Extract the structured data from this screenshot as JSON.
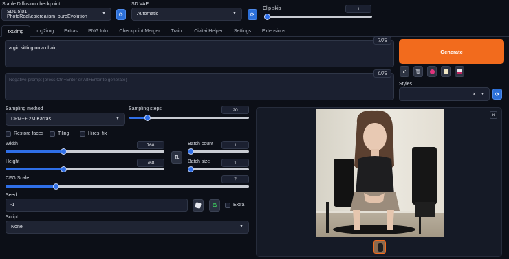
{
  "header": {
    "checkpoint_label": "Stable Diffusion checkpoint",
    "checkpoint_value": "SD1.5\\01 PhotoReal\\epicrealism_pureEvolution",
    "vae_label": "SD VAE",
    "vae_value": "Automatic",
    "clip_skip_label": "Clip skip",
    "clip_skip_value": "1",
    "clip_skip_level": 0.0
  },
  "tabs": [
    "txt2img",
    "img2img",
    "Extras",
    "PNG Info",
    "Checkpoint Merger",
    "Train",
    "Civitai Helper",
    "Settings",
    "Extensions"
  ],
  "prompt": {
    "text": "a girl sitting on a chair,",
    "token_count": "7/75",
    "negative_placeholder": "Negative prompt (press Ctrl+Enter or Alt+Enter to generate)",
    "negative_token_count": "0/75"
  },
  "generate_label": "Generate",
  "tool_icons": [
    "arrow-icon",
    "trash-icon",
    "red-card-icon",
    "clipboard-icon",
    "save-style-icon"
  ],
  "styles": {
    "label": "Styles",
    "clear_icon": "×"
  },
  "sampling": {
    "method_label": "Sampling method",
    "method_value": "DPM++ 2M Karras",
    "steps_label": "Sampling steps",
    "steps_value": "20",
    "steps_level": 0.13
  },
  "options": {
    "restore_faces": "Restore faces",
    "tiling": "Tiling",
    "hires_fix": "Hires. fix"
  },
  "size": {
    "width_label": "Width",
    "width_value": "768",
    "width_level": 0.36,
    "height_label": "Height",
    "height_value": "768",
    "height_level": 0.36,
    "swap_icon": "⇅"
  },
  "batch": {
    "count_label": "Batch count",
    "count_value": "1",
    "count_level": 0.0,
    "size_label": "Batch size",
    "size_value": "1",
    "size_level": 0.0
  },
  "cfg": {
    "label": "CFG Scale",
    "value": "7",
    "level": 0.2
  },
  "seed": {
    "label": "Seed",
    "value": "-1",
    "extra_label": "Extra"
  },
  "script": {
    "label": "Script",
    "value": "None"
  },
  "output": {
    "close_icon": "×"
  },
  "colors": {
    "accent": "#2f6fe8",
    "generate": "#f26b1d",
    "background": "#0c0f17"
  }
}
